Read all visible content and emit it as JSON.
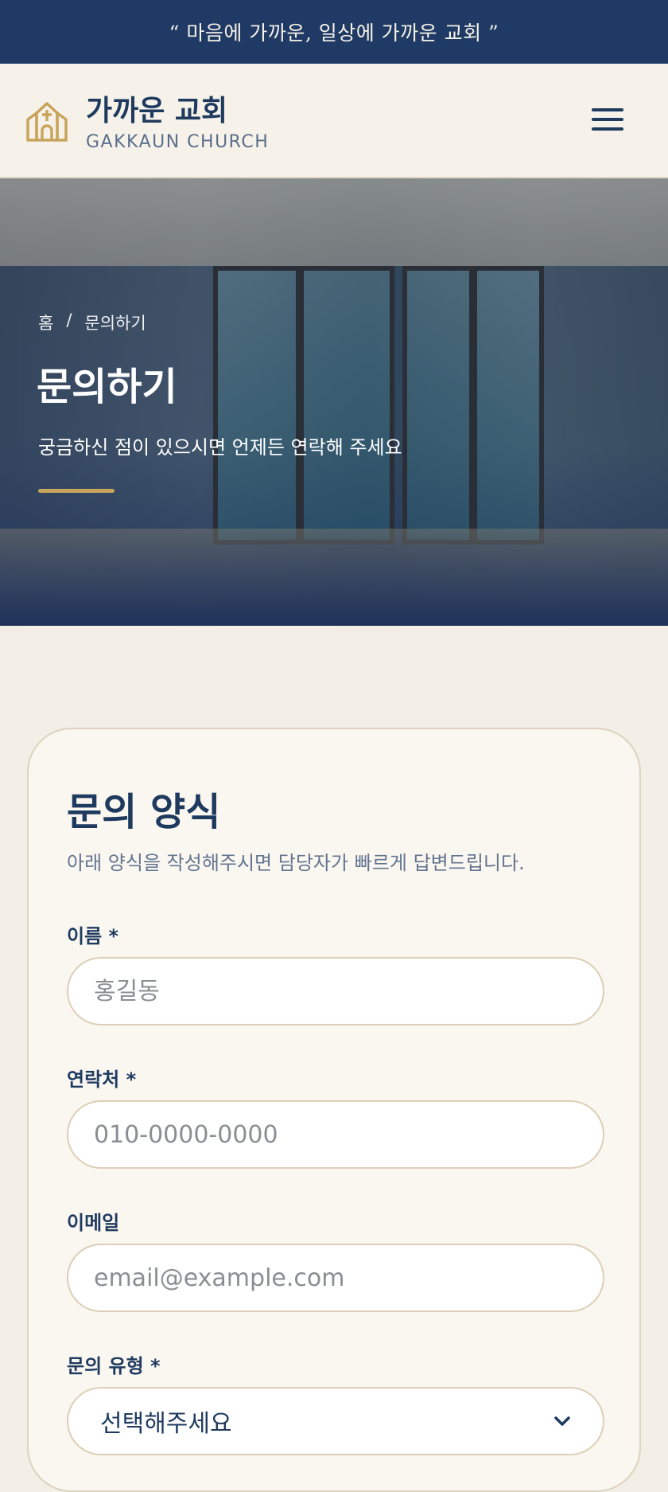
{
  "topbar": {
    "quote": "“ 마음에 가까운, 일상에 가까운 교회 ”"
  },
  "header": {
    "brand_ko": "가까운 교회",
    "brand_en": "GAKKAUN CHURCH",
    "logo_icon": "church-icon",
    "menu_icon": "hamburger-menu-icon"
  },
  "hero": {
    "breadcrumb": {
      "home": "홈",
      "separator": "/",
      "current": "문의하기"
    },
    "title": "문의하기",
    "subtitle": "궁금하신 점이 있으시면 언제든 연락해 주세요"
  },
  "form": {
    "title": "문의 양식",
    "description": "아래 양식을 작성해주시면 담당자가 빠르게 답변드립니다.",
    "fields": [
      {
        "label": "이름 *",
        "placeholder": "홍길동",
        "value": ""
      },
      {
        "label": "연락처 *",
        "placeholder": "010-0000-0000",
        "value": ""
      },
      {
        "label": "이메일",
        "placeholder": "email@example.com",
        "value": ""
      }
    ],
    "inquiry_type": {
      "label": "문의 유형 *",
      "selected": "선택해주세요",
      "icon": "chevron-down-icon"
    }
  },
  "colors": {
    "navy": "#1f3a64",
    "gold": "#c9a45c",
    "cream": "#f3efe7"
  }
}
